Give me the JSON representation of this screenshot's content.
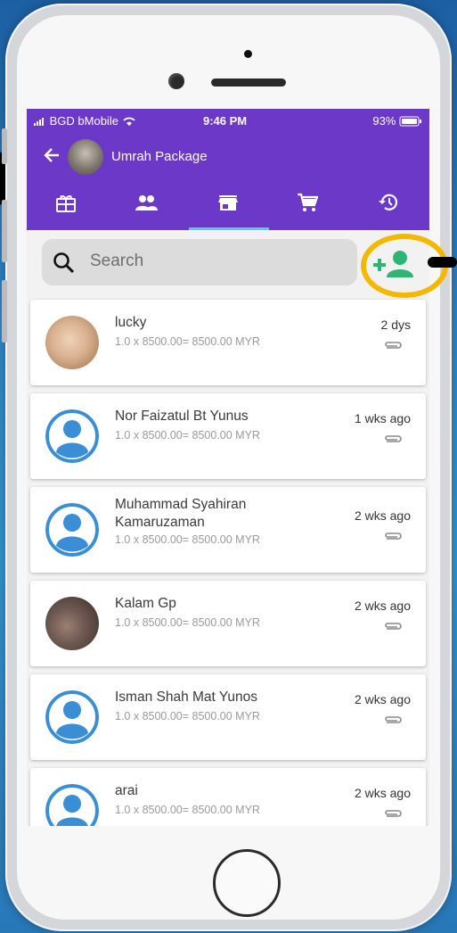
{
  "status_bar": {
    "carrier": "BGD bMobile",
    "time": "9:46 PM",
    "battery": "93%"
  },
  "header": {
    "title": "Umrah Package"
  },
  "tabs": [
    {
      "icon": "gift-icon"
    },
    {
      "icon": "people-icon"
    },
    {
      "icon": "store-icon",
      "selected": true
    },
    {
      "icon": "cart-icon"
    },
    {
      "icon": "history-icon"
    }
  ],
  "search": {
    "placeholder": "Search"
  },
  "colors": {
    "appbar": "#6b38c7",
    "accent_green": "#2eb573",
    "tab_indicator": "#4dd0e1",
    "highlight": "#f5b800"
  },
  "customers": [
    {
      "name": "lucky",
      "detail": "1.0 x 8500.00= 8500.00 MYR",
      "time": "2 dys",
      "avatar": "photo"
    },
    {
      "name": "Nor Faizatul Bt Yunus",
      "detail": "1.0 x 8500.00= 8500.00 MYR",
      "time": "1 wks ago",
      "avatar": "default-user-icon"
    },
    {
      "name": "Muhammad Syahiran Kamaruzaman",
      "detail": "1.0 x 8500.00= 8500.00 MYR",
      "time": "2 wks ago",
      "avatar": "default-user-icon"
    },
    {
      "name": "Kalam Gp",
      "detail": "1.0 x 8500.00= 8500.00 MYR",
      "time": "2 wks ago",
      "avatar": "photo"
    },
    {
      "name": "Isman Shah Mat Yunos",
      "detail": "1.0 x 8500.00= 8500.00 MYR",
      "time": "2 wks ago",
      "avatar": "default-user-icon"
    },
    {
      "name": "arai",
      "detail": "1.0 x 8500.00= 8500.00 MYR",
      "time": "2 wks ago",
      "avatar": "default-user-icon"
    }
  ]
}
